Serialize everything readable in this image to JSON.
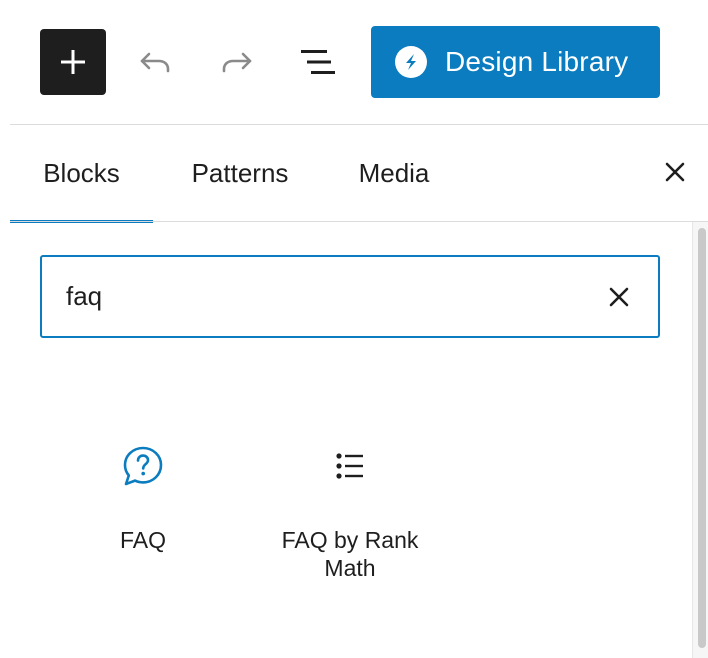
{
  "toolbar": {
    "add_block": {
      "icon": "plus-icon"
    },
    "undo": {
      "icon": "undo-icon"
    },
    "redo": {
      "icon": "redo-icon"
    },
    "list_view": {
      "icon": "list-view-icon"
    },
    "design_library": {
      "label": "Design Library",
      "icon": "stackable-logo-icon",
      "color": "#0a7cbf"
    }
  },
  "tabs": [
    {
      "label": "Blocks",
      "active": true
    },
    {
      "label": "Patterns",
      "active": false
    },
    {
      "label": "Media",
      "active": false
    }
  ],
  "close": {
    "icon": "close-icon"
  },
  "search": {
    "value": "faq",
    "clear_icon": "close-icon"
  },
  "results": [
    {
      "label": "FAQ",
      "icon": "question-bubble-icon",
      "icon_color": "#0a7cbf"
    },
    {
      "label": "FAQ by Rank Math",
      "icon": "list-bullets-icon",
      "icon_color": "#1e1e1e"
    }
  ],
  "colors": {
    "accent": "#0a7cbf",
    "dark": "#1e1e1e",
    "border": "#dcdcde"
  }
}
